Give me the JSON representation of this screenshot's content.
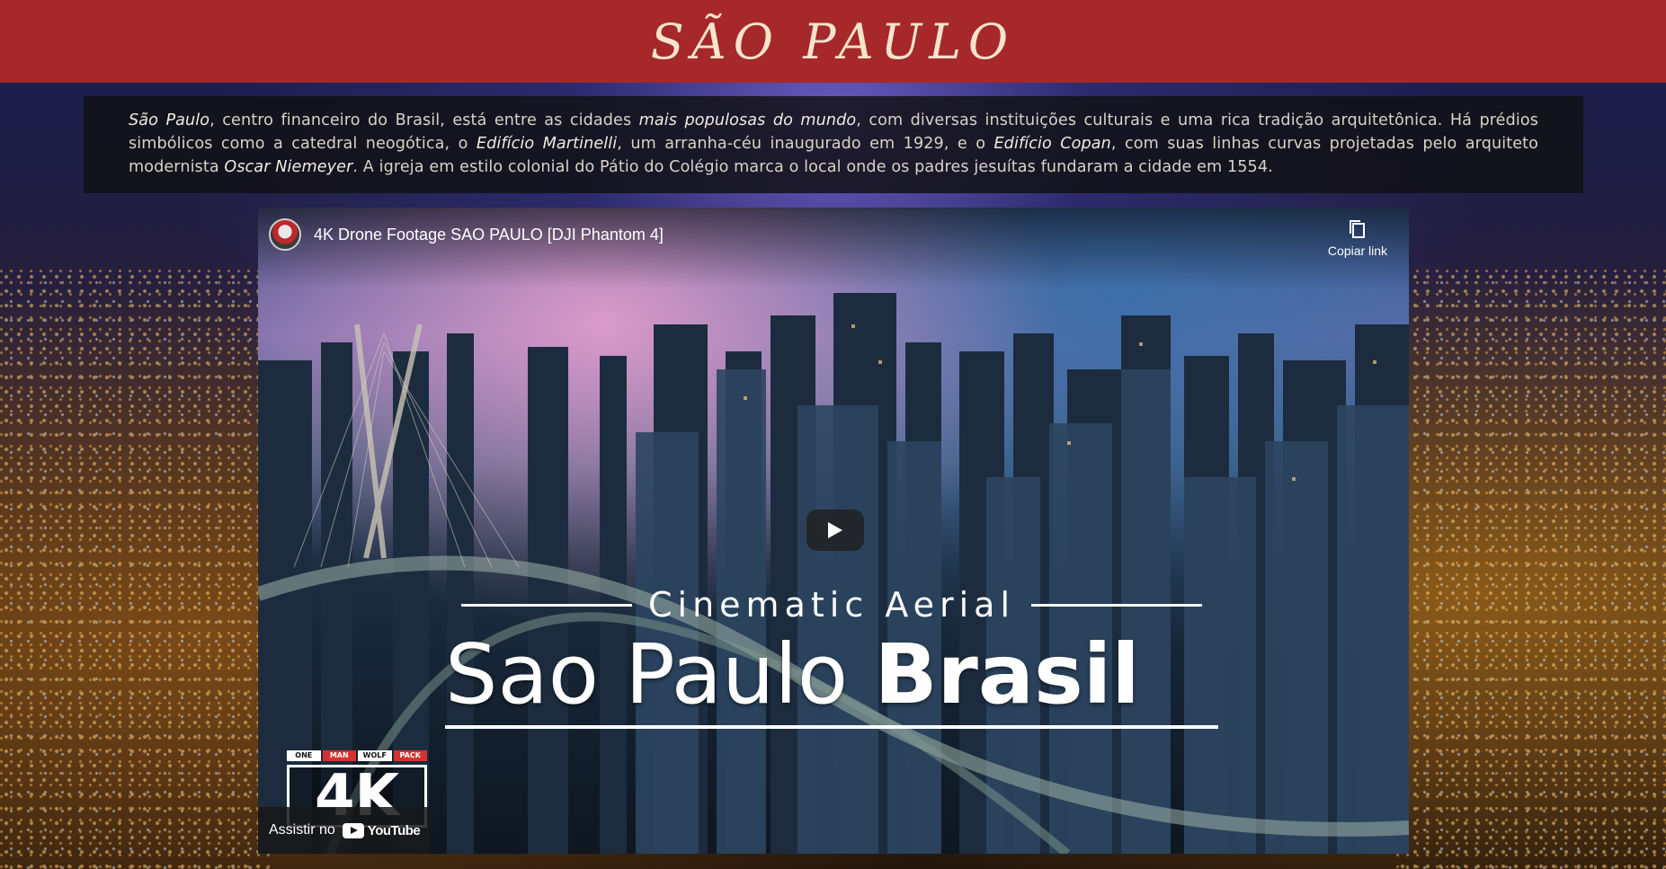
{
  "header": {
    "title": "SÃO PAULO",
    "background_color": "#a6282b"
  },
  "intro": {
    "city": "São Paulo",
    "text_1": ", centro financeiro do Brasil, está entre as cidades ",
    "emph_1": "mais populosas do mundo",
    "text_2": ", com diversas instituições culturais e uma rica tradição arquitetônica. Há prédios simbólicos como a catedral neogótica, o ",
    "emph_2": "Edifício Martinelli",
    "text_3": ", um arranha-céu inaugurado em 1929, e o ",
    "emph_3": "Edifício Copan",
    "text_4": ", com suas linhas curvas projetadas pelo arquiteto modernista ",
    "emph_4": "Oscar Niemeyer",
    "text_5": ". A igreja em estilo colonial do Pátio do Colégio marca o local onde os padres jesuítas fundaram a cidade em 1554."
  },
  "video": {
    "title": "4K Drone Footage SAO PAULO [DJI Phantom 4]",
    "copy_link_label": "Copiar link",
    "overlay_subtitle": "Cinematic Aerial",
    "overlay_title_light": "Sao Paulo ",
    "overlay_title_bold": "Brasil",
    "badge_strip": [
      "ONE",
      "MAN",
      "WOLF",
      "PACK"
    ],
    "badge_text": "4K",
    "watch_on_label": "Assistir no",
    "youtube_label": "YouTube"
  },
  "icons": {
    "play": "play-icon",
    "copy": "copy-icon",
    "youtube": "youtube-logo-icon",
    "avatar": "channel-avatar"
  }
}
